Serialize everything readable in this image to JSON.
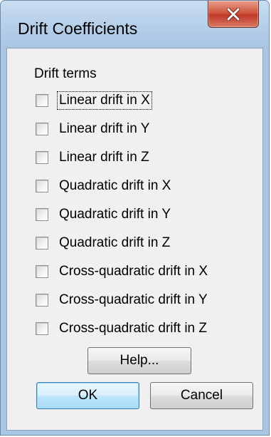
{
  "window": {
    "title": "Drift Coefficients",
    "close_icon": "close-x-icon"
  },
  "group": {
    "label": "Drift terms"
  },
  "checkboxes": [
    {
      "label": "Linear drift in X",
      "checked": false,
      "focused": true
    },
    {
      "label": "Linear drift in Y",
      "checked": false,
      "focused": false
    },
    {
      "label": "Linear drift in Z",
      "checked": false,
      "focused": false
    },
    {
      "label": "Quadratic drift in X",
      "checked": false,
      "focused": false
    },
    {
      "label": "Quadratic drift in Y",
      "checked": false,
      "focused": false
    },
    {
      "label": "Quadratic drift in Z",
      "checked": false,
      "focused": false
    },
    {
      "label": "Cross-quadratic drift in X",
      "checked": false,
      "focused": false
    },
    {
      "label": "Cross-quadratic drift in Y",
      "checked": false,
      "focused": false
    },
    {
      "label": "Cross-quadratic drift in Z",
      "checked": false,
      "focused": false
    }
  ],
  "buttons": {
    "help": "Help...",
    "ok": "OK",
    "cancel": "Cancel"
  },
  "colors": {
    "frame": "#a9c6e4",
    "client": "#f0f0f0",
    "close_button": "#c0392b",
    "default_button_border": "#3c7fb1"
  }
}
